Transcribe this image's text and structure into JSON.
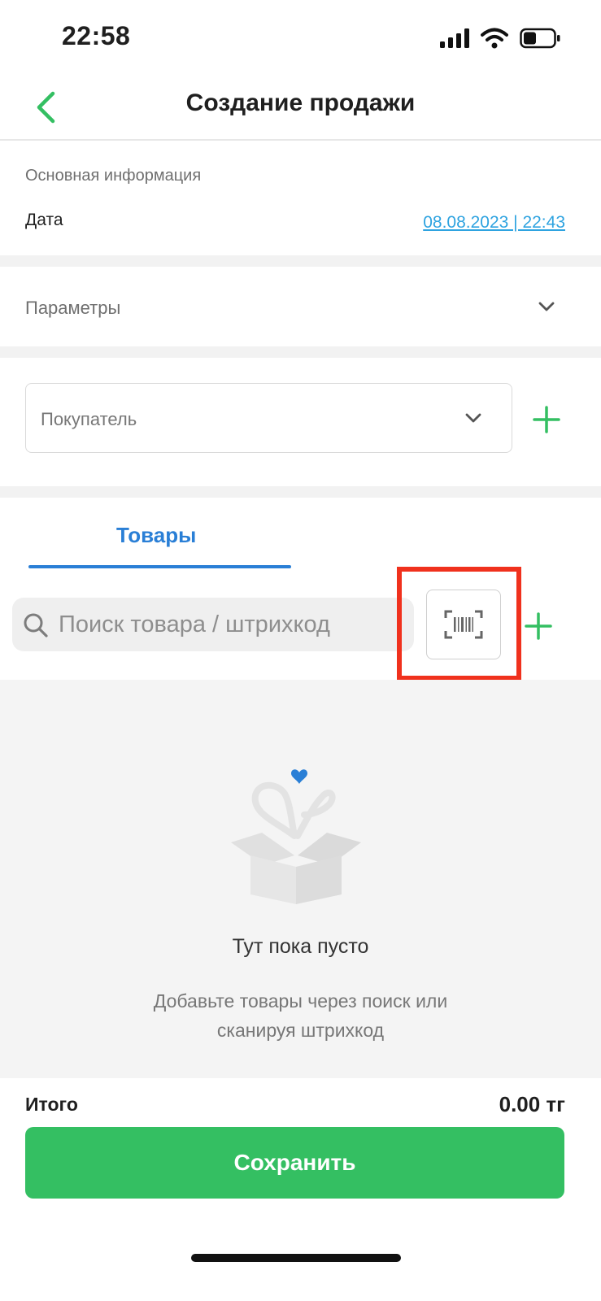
{
  "status_bar": {
    "time": "22:58"
  },
  "nav": {
    "title": "Создание продажи"
  },
  "main_info": {
    "section_label": "Основная информация",
    "date_label": "Дата",
    "date_value": "08.08.2023 | 22:43"
  },
  "params": {
    "label": "Параметры"
  },
  "buyer": {
    "placeholder": "Покупатель"
  },
  "tabs": {
    "goods_label": "Товары"
  },
  "search": {
    "placeholder": "Поиск товара / штрихкод"
  },
  "empty_state": {
    "title": "Тут пока пусто",
    "desc_line1": "Добавьте товары через поиск или",
    "desc_line2": "сканируя штрихкод"
  },
  "total": {
    "label": "Итого",
    "value": "0.00 тг"
  },
  "save": {
    "label": "Сохранить"
  },
  "colors": {
    "accent_green": "#34bf62",
    "tab_blue": "#2a7fd6",
    "link_blue": "#2ea3e0",
    "highlight_red": "#f0311d"
  }
}
